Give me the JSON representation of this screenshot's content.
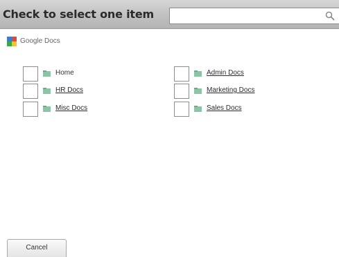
{
  "header": {
    "title": "Check to select one item",
    "search": {
      "value": "",
      "placeholder": ""
    }
  },
  "source": {
    "label": "Google Docs",
    "icon": "google-docs-logo"
  },
  "items": [
    {
      "label": "Home",
      "checked": false,
      "link": false
    },
    {
      "label": "HR Docs",
      "checked": false,
      "link": true
    },
    {
      "label": "Misc Docs",
      "checked": false,
      "link": true
    },
    {
      "label": "Admin Docs",
      "checked": false,
      "link": true
    },
    {
      "label": "Marketing Docs",
      "checked": false,
      "link": true
    },
    {
      "label": "Sales Docs",
      "checked": false,
      "link": true
    }
  ],
  "footer": {
    "cancel_label": "Cancel"
  },
  "colors": {
    "header_bg": "#c2c2c2",
    "folder": "#7fb89a"
  }
}
